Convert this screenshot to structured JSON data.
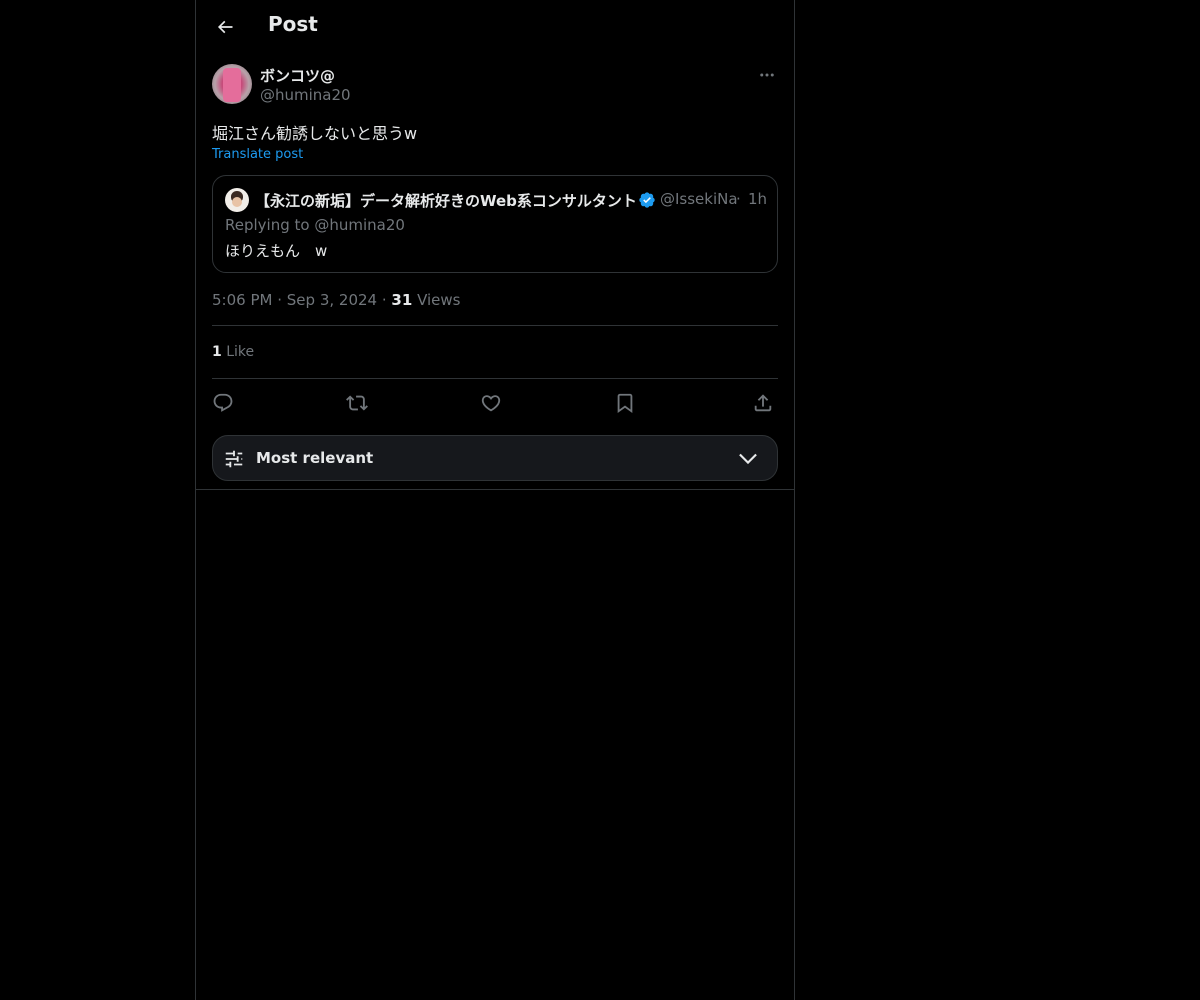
{
  "header": {
    "title": "Post"
  },
  "post": {
    "author_name": "ボンコツ@",
    "author_handle": "@humina20",
    "text": "堀江さん勧誘しないと思うw",
    "translate_label": "Translate post",
    "time": "5:06 PM",
    "date": "Sep 3, 2024",
    "views_count": "31",
    "views_label": "Views",
    "likes_count": "1",
    "likes_label": "Like"
  },
  "quoted_post": {
    "author_name": "【永江の新垢】データ解析好きのWeb系コンサルタント永",
    "author_handle": "@IssekiNa",
    "time": "1h",
    "replying_to": "Replying to @humina20",
    "text": "ほりえもん　w"
  },
  "sort": {
    "label": "Most relevant"
  },
  "icons": {
    "back": "arrow-left-icon",
    "more": "more-horizontal-icon",
    "verified": "verified-badge-icon",
    "reply": "reply-icon",
    "repost": "repost-icon",
    "like": "heart-icon",
    "bookmark": "bookmark-icon",
    "share": "share-icon",
    "sort": "sliders-icon",
    "chevron": "chevron-down-icon"
  },
  "colors": {
    "background": "#000000",
    "text": "#e7e9ea",
    "muted": "#71767b",
    "link": "#1d9bf0",
    "border": "#2f3336",
    "verified": "#1d9bf0"
  }
}
